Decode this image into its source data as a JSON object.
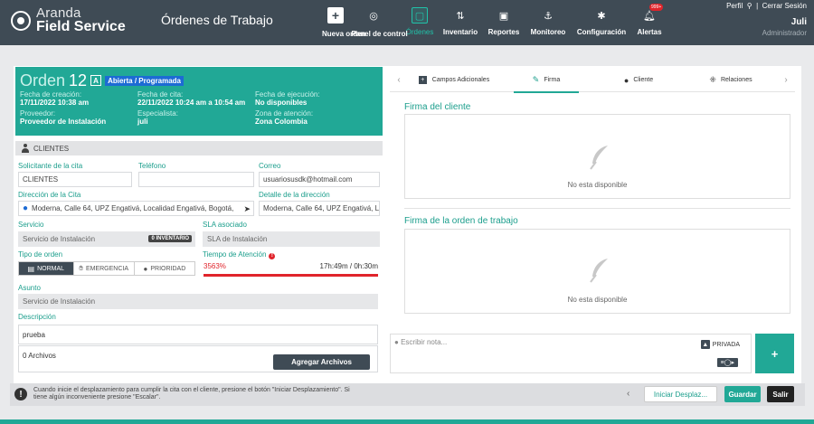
{
  "header": {
    "brand_line1": "Aranda",
    "brand_line2": "Field Service",
    "page_title": "Órdenes de Trabajo",
    "nav": [
      {
        "label": "Nueva orden",
        "icon": "plus-icon"
      },
      {
        "label": "Panel de control",
        "icon": "dashboard-icon"
      },
      {
        "label": "Órdenes",
        "icon": "orders-icon"
      },
      {
        "label": "Inventario",
        "icon": "inventory-icon"
      },
      {
        "label": "Reportes",
        "icon": "reports-icon"
      },
      {
        "label": "Monitoreo",
        "icon": "monitor-icon"
      },
      {
        "label": "Configuración",
        "icon": "gear-icon"
      },
      {
        "label": "Alertas",
        "icon": "bell-icon",
        "badge": "999+"
      }
    ],
    "user_links": "Perfil",
    "logout": "Cerrar Sesión",
    "user_name": "Juli",
    "user_role": "Administrador"
  },
  "order": {
    "word": "Orden",
    "number": "12",
    "type_letter": "A",
    "status": "Abierta / Programada",
    "creation_label": "Fecha de creación:",
    "creation_value": "17/11/2022 10:38 am",
    "appointment_label": "Fecha de cita:",
    "appointment_value": "22/11/2022 10:24 am a 10:54 am",
    "execution_label": "Fecha de ejecución:",
    "execution_value": "No disponibles",
    "provider_label": "Proveedor:",
    "provider_value": "Proveedor de Instalación",
    "specialist_label": "Especialista:",
    "specialist_value": "juli",
    "zone_label": "Zona de atención:",
    "zone_value": "Zona Colombia"
  },
  "clients": {
    "section": "CLIENTES",
    "requester_label": "Solicitante de la cita",
    "requester_value": "CLIENTES",
    "phone_label": "Teléfono",
    "phone_value": "",
    "email_label": "Correo",
    "email_value": "usuariosusdk@hotmail.com",
    "address_label": "Dirección de la Cita",
    "address_value": "Moderna, Calle 64, UPZ Engativá, Localidad Engativá, Bogotá,",
    "address_detail_label": "Detalle de la dirección",
    "address_detail_value": "Moderna, Calle 64, UPZ Engativá, L",
    "service_label": "Servicio",
    "service_value": "Servicio de Instalación",
    "inventory_tag": "0 INVENTARIO",
    "sla_label": "SLA asociado",
    "sla_value": "SLA de Instalación",
    "order_type_label": "Tipo de orden",
    "order_types": [
      "NORMAL",
      "EMERGENCIA",
      "PRIORIDAD"
    ],
    "attention_label": "Tiempo de Atención",
    "attention_pct": "3563%",
    "attention_range": "17h:49m / 0h:30m",
    "attention_progress": 1.0,
    "subject_label": "Asunto",
    "subject_value": "Servicio de Instalación",
    "description_label": "Descripción",
    "description_value": "prueba",
    "files_value": "0 Archivos",
    "add_files": "Agregar Archivos"
  },
  "tabs": [
    "Campos Adicionales",
    "Firma",
    "Cliente",
    "Relaciones"
  ],
  "signatures": {
    "client_title": "Firma del cliente",
    "client_empty": "No esta disponible",
    "order_title": "Firma de la orden de trabajo",
    "order_empty": "No esta disponible"
  },
  "notes": {
    "placeholder": "Escribir nota...",
    "private_label": "PRIVADA",
    "send": "+"
  },
  "footer": {
    "message": "Cuando inicie el desplazamiento para cumplir la cita con el cliente, presione el botón \"Iniciar Desplazamiento\". Si tiene algún inconveniente presione \"Escalar\".",
    "start": "Iniciar Desplaz...",
    "save": "Guardar",
    "exit": "Salir"
  },
  "colors": {
    "topbar": "#3f4b55",
    "accent": "#21a896",
    "status_blue": "#1d6bd4",
    "alert_red": "#e0242b"
  }
}
